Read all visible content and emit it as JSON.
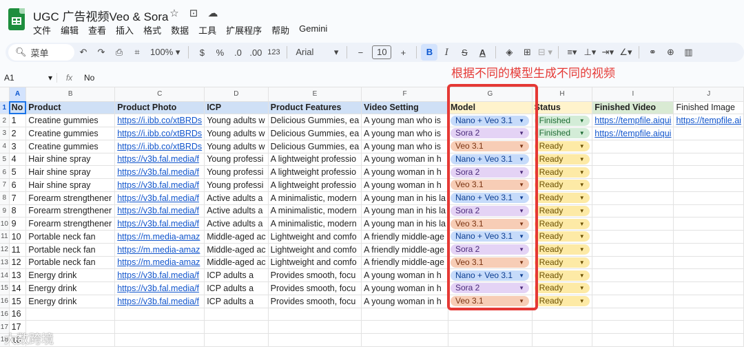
{
  "window": {
    "title": "UGC 广告视频Veo & Sora",
    "menu": [
      "文件",
      "编辑",
      "查看",
      "插入",
      "格式",
      "数据",
      "工具",
      "扩展程序",
      "帮助",
      "Gemini"
    ]
  },
  "toolbar": {
    "search_label": "菜单",
    "zoom": "100%",
    "currency": "$",
    "percent": "%",
    "dec_dec": ".0",
    "dec_inc": ".00",
    "number_format": "123",
    "font": "Arial",
    "font_size": "10",
    "bold": "B",
    "italic": "I",
    "strike": "S",
    "text_color": "A"
  },
  "formula_bar": {
    "cell_ref": "A1",
    "fx": "fx",
    "value": "No"
  },
  "annotation": "根据不同的模型生成不同的视频",
  "watermark": "大数跨境",
  "sheet": {
    "columns": [
      "A",
      "B",
      "C",
      "D",
      "E",
      "F",
      "G",
      "H",
      "I",
      "J"
    ],
    "header": [
      "No",
      "Product",
      "Product Photo",
      "ICP",
      "Product Features",
      "Video Setting",
      "Model",
      "Status",
      "Finished Video",
      "Finished Image"
    ],
    "rows": [
      [
        "1",
        "Creatine gummies",
        "https://i.ibb.co/xtBRDs",
        "Young adults w",
        "Delicious Gummies, ea",
        "A young man who is",
        "Nano + Veo 3.1",
        "Finished",
        "https://tempfile.aiqui",
        "https://tempfile.ai"
      ],
      [
        "2",
        "Creatine gummies",
        "https://i.ibb.co/xtBRDs",
        "Young adults w",
        "Delicious Gummies, ea",
        "A young man who is",
        "Sora 2",
        "Finished",
        "https://tempfile.aiqui",
        ""
      ],
      [
        "3",
        "Creatine gummies",
        "https://i.ibb.co/xtBRDs",
        "Young adults w",
        "Delicious Gummies, ea",
        "A young man who is",
        "Veo 3.1",
        "Ready",
        "",
        ""
      ],
      [
        "4",
        "Hair shine spray",
        "https://v3b.fal.media/f",
        "Young professi",
        "A lightweight professio",
        "A young woman in h",
        "Nano + Veo 3.1",
        "Ready",
        "",
        ""
      ],
      [
        "5",
        "Hair shine spray",
        "https://v3b.fal.media/f",
        "Young professi",
        "A lightweight professio",
        "A young woman in h",
        "Sora 2",
        "Ready",
        "",
        ""
      ],
      [
        "6",
        "Hair shine spray",
        "https://v3b.fal.media/f",
        "Young professi",
        "A lightweight professio",
        "A young woman in h",
        "Veo 3.1",
        "Ready",
        "",
        ""
      ],
      [
        "7",
        "Forearm strengthener",
        "https://v3b.fal.media/f",
        "Active adults a",
        "A minimalistic, modern",
        "A young man in his la",
        "Nano + Veo 3.1",
        "Ready",
        "",
        ""
      ],
      [
        "8",
        "Forearm strengthener",
        "https://v3b.fal.media/f",
        "Active adults a",
        "A minimalistic, modern",
        "A young man in his la",
        "Sora 2",
        "Ready",
        "",
        ""
      ],
      [
        "9",
        "Forearm strengthener",
        "https://v3b.fal.media/f",
        "Active adults a",
        "A minimalistic, modern",
        "A young man in his la",
        "Veo 3.1",
        "Ready",
        "",
        ""
      ],
      [
        "10",
        "Portable neck fan",
        "https://m.media-amaz",
        "Middle-aged ac",
        "Lightweight and comfo",
        "A friendly middle-age",
        "Nano + Veo 3.1",
        "Ready",
        "",
        ""
      ],
      [
        "11",
        "Portable neck fan",
        "https://m.media-amaz",
        "Middle-aged ac",
        "Lightweight and comfo",
        "A friendly middle-age",
        "Sora 2",
        "Ready",
        "",
        ""
      ],
      [
        "12",
        "Portable neck fan",
        "https://m.media-amaz",
        "Middle-aged ac",
        "Lightweight and comfo",
        "A friendly middle-age",
        "Veo 3.1",
        "Ready",
        "",
        ""
      ],
      [
        "13",
        "Energy drink",
        "https://v3b.fal.media/f",
        "ICP adults a",
        "Provides smooth, focu",
        "A young woman in h",
        "Nano + Veo 3.1",
        "Ready",
        "",
        ""
      ],
      [
        "14",
        "Energy drink",
        "https://v3b.fal.media/f",
        "ICP adults a",
        "Provides smooth, focu",
        "A young woman in h",
        "Sora 2",
        "Ready",
        "",
        ""
      ],
      [
        "15",
        "Energy drink",
        "https://v3b.fal.media/f",
        "ICP adults a",
        "Provides smooth, focu",
        "A young woman in h",
        "Veo 3.1",
        "Ready",
        "",
        ""
      ]
    ],
    "empty_rows": [
      "16",
      "17",
      "18"
    ]
  }
}
